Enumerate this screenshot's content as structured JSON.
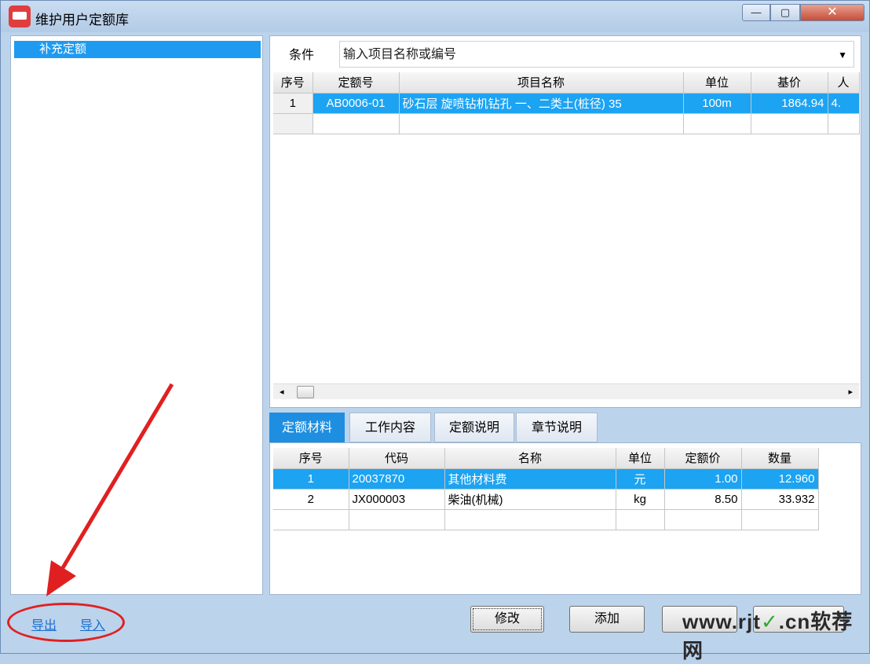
{
  "window": {
    "title": "维护用户定额库",
    "min_glyph": "—",
    "max_glyph": "▢",
    "close_glyph": "✕"
  },
  "sidebar": {
    "items": [
      {
        "label": "补充定额"
      }
    ]
  },
  "filter": {
    "label": "条件",
    "placeholder": "输入项目名称或编号",
    "dropdown_glyph": "▼"
  },
  "main_table": {
    "columns": [
      "序号",
      "定额号",
      "项目名称",
      "单位",
      "基价",
      "人"
    ],
    "rows": [
      [
        "1",
        "AB0006-01",
        "砂石层 旋喷钻机钻孔 一、二类土(桩径) 35",
        "100m",
        "1864.94",
        "4."
      ]
    ]
  },
  "hscroll": {
    "left_glyph": "◂",
    "right_glyph": "▸"
  },
  "tabs": [
    {
      "label": "定额材料",
      "active": true
    },
    {
      "label": "工作内容",
      "active": false
    },
    {
      "label": "定额说明",
      "active": false
    },
    {
      "label": "章节说明",
      "active": false
    }
  ],
  "material_table": {
    "columns": [
      "序号",
      "代码",
      "名称",
      "单位",
      "定额价",
      "数量"
    ],
    "rows": [
      [
        "1",
        "20037870",
        "其他材料费",
        "元",
        "1.00",
        "12.960"
      ],
      [
        "2",
        "JX000003",
        "柴油(机械)",
        "kg",
        "8.50",
        "33.932"
      ]
    ]
  },
  "footer": {
    "export_label": "导出",
    "import_label": "导入",
    "modify_label": "修改",
    "add_label": "添加",
    "third_label": "",
    "fourth_label": ""
  },
  "watermark": {
    "text_pre": "www.rjt",
    "check": "✓",
    "text_post": ".cn软荐网"
  },
  "colors": {
    "selection": "#1ca3f2",
    "active_tab": "#1e8ee0",
    "annotation": "#e02020",
    "link": "#1a6fd0"
  }
}
